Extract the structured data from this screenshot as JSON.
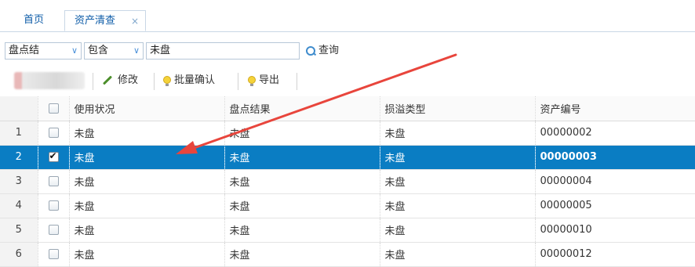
{
  "tabs": [
    {
      "label": "首页"
    },
    {
      "label": "资产清查",
      "close": "×"
    }
  ],
  "filter": {
    "field": "盘点结",
    "operator": "包含",
    "value": "未盘",
    "query_label": "查询",
    "arrow": "∨"
  },
  "toolbar": {
    "edit_label": "修改",
    "batch_confirm_label": "批量确认",
    "export_label": "导出"
  },
  "table": {
    "headers": [
      "使用状况",
      "盘点结果",
      "损溢类型",
      "资产编号"
    ],
    "rows": [
      {
        "n": "1",
        "checked": false,
        "cells": [
          "未盘",
          "未盘",
          "未盘",
          "00000002"
        ]
      },
      {
        "n": "2",
        "checked": true,
        "cells": [
          "未盘",
          "未盘",
          "未盘",
          "00000003"
        ]
      },
      {
        "n": "3",
        "checked": false,
        "cells": [
          "未盘",
          "未盘",
          "未盘",
          "00000004"
        ]
      },
      {
        "n": "4",
        "checked": false,
        "cells": [
          "未盘",
          "未盘",
          "未盘",
          "00000005"
        ]
      },
      {
        "n": "5",
        "checked": false,
        "cells": [
          "未盘",
          "未盘",
          "未盘",
          "00000010"
        ]
      },
      {
        "n": "6",
        "checked": false,
        "cells": [
          "未盘",
          "未盘",
          "未盘",
          "00000012"
        ]
      }
    ],
    "selected_row": 1
  },
  "colors": {
    "selected_row": "#0a7dc3",
    "annotation_arrow": "#e8453c",
    "tab_text": "#0e5ca8"
  },
  "icons": {
    "query": "search-icon",
    "edit": "pencil-icon",
    "batch_confirm": "lightbulb-icon",
    "export": "lightbulb-icon"
  }
}
